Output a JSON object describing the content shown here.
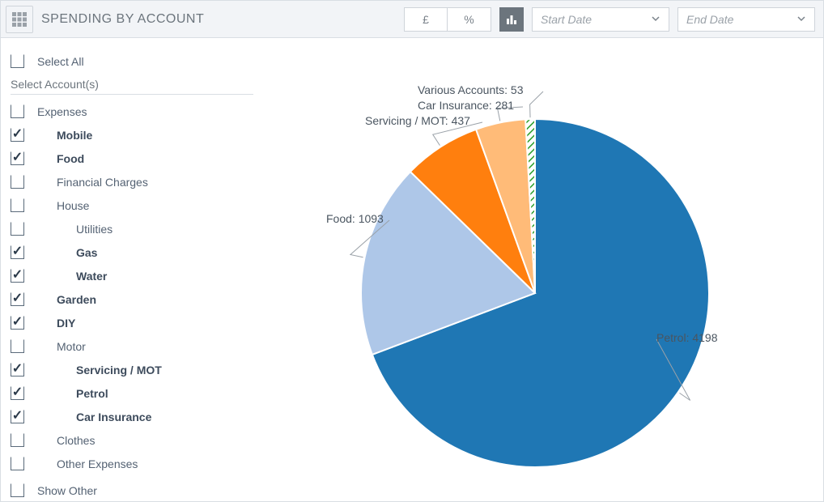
{
  "header": {
    "title": "SPENDING BY ACCOUNT",
    "currency_button": "£",
    "percent_button": "%",
    "start_date_placeholder": "Start Date",
    "end_date_placeholder": "End Date"
  },
  "sidebar": {
    "select_all": "Select All",
    "subheader": "Select Account(s)",
    "show_other": "Show Other",
    "items": [
      {
        "label": "Expenses",
        "checked": false,
        "bold": false,
        "indent": 0
      },
      {
        "label": "Mobile",
        "checked": true,
        "bold": true,
        "indent": 1
      },
      {
        "label": "Food",
        "checked": true,
        "bold": true,
        "indent": 1
      },
      {
        "label": "Financial Charges",
        "checked": false,
        "bold": false,
        "indent": 1
      },
      {
        "label": "House",
        "checked": false,
        "bold": false,
        "indent": 1
      },
      {
        "label": "Utilities",
        "checked": false,
        "bold": false,
        "indent": 2
      },
      {
        "label": "Gas",
        "checked": true,
        "bold": true,
        "indent": 2
      },
      {
        "label": "Water",
        "checked": true,
        "bold": true,
        "indent": 2
      },
      {
        "label": "Garden",
        "checked": true,
        "bold": true,
        "indent": 1
      },
      {
        "label": "DIY",
        "checked": true,
        "bold": true,
        "indent": 1
      },
      {
        "label": "Motor",
        "checked": false,
        "bold": false,
        "indent": 1
      },
      {
        "label": "Servicing / MOT",
        "checked": true,
        "bold": true,
        "indent": 2
      },
      {
        "label": "Petrol",
        "checked": true,
        "bold": true,
        "indent": 2
      },
      {
        "label": "Car Insurance",
        "checked": true,
        "bold": true,
        "indent": 2
      },
      {
        "label": "Clothes",
        "checked": false,
        "bold": false,
        "indent": 1
      },
      {
        "label": "Other Expenses",
        "checked": false,
        "bold": false,
        "indent": 1
      }
    ]
  },
  "chart_data": {
    "type": "pie",
    "title": "",
    "series": [
      {
        "name": "Petrol",
        "value": 4198,
        "color": "#1f77b4"
      },
      {
        "name": "Food",
        "value": 1093,
        "color": "#aec7e8"
      },
      {
        "name": "Servicing / MOT",
        "value": 437,
        "color": "#ff7f0e"
      },
      {
        "name": "Car Insurance",
        "value": 281,
        "color": "#ffbb78"
      },
      {
        "name": "Various Accounts",
        "value": 53,
        "color": "#2ca02c",
        "pattern": "hatch"
      }
    ],
    "labels": {
      "petrol": "Petrol: 4198",
      "food": "Food: 1093",
      "servicing": "Servicing / MOT: 437",
      "car_insurance": "Car Insurance: 281",
      "various": "Various Accounts: 53"
    }
  }
}
